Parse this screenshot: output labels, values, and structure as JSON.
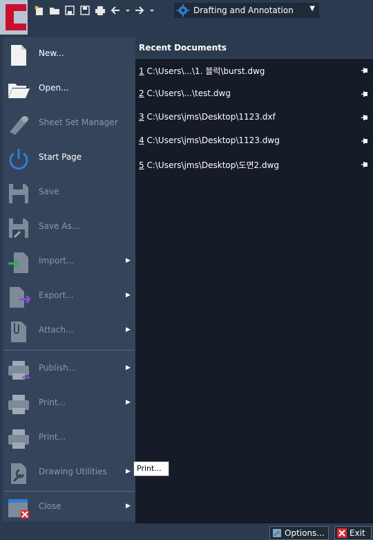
{
  "toolbar": {
    "workspace": "Drafting and Annotation"
  },
  "menu": {
    "items": [
      {
        "label": "New...",
        "icon": "new-icon",
        "enabled": true,
        "submenu": false
      },
      {
        "label": "Open...",
        "icon": "open-folder-icon",
        "enabled": true,
        "submenu": false
      },
      {
        "label": "Sheet Set Manager",
        "icon": "sheet-set-icon",
        "enabled": false,
        "submenu": false
      },
      {
        "label": "Start Page",
        "icon": "power-icon",
        "enabled": true,
        "submenu": false
      },
      {
        "label": "Save",
        "icon": "save-icon",
        "enabled": false,
        "submenu": false
      },
      {
        "label": "Save As...",
        "icon": "save-as-icon",
        "enabled": false,
        "submenu": false
      },
      {
        "label": "Import...",
        "icon": "import-icon",
        "enabled": false,
        "submenu": true
      },
      {
        "label": "Export...",
        "icon": "export-icon",
        "enabled": false,
        "submenu": true
      },
      {
        "label": "Attach...",
        "icon": "attach-icon",
        "enabled": false,
        "submenu": true
      },
      {
        "label": "Publish...",
        "icon": "publish-icon",
        "enabled": false,
        "submenu": true
      },
      {
        "label": "Print...",
        "icon": "print-icon",
        "enabled": false,
        "submenu": true
      },
      {
        "label": "Print...",
        "icon": "print-icon",
        "enabled": false,
        "submenu": false
      },
      {
        "label": "Drawing Utilities",
        "icon": "wrench-icon",
        "enabled": false,
        "submenu": true
      },
      {
        "label": "Close",
        "icon": "close-drawing-icon",
        "enabled": false,
        "submenu": true
      }
    ]
  },
  "recent": {
    "title": "Recent Documents",
    "items": [
      {
        "num": "1",
        "path": " C:\\Users\\...\\1. 블럭\\burst.dwg"
      },
      {
        "num": "2",
        "path": " C:\\Users\\...\\test.dwg"
      },
      {
        "num": "3",
        "path": " C:\\Users\\jms\\Desktop\\1123.dxf"
      },
      {
        "num": "4",
        "path": " C:\\Users\\jms\\Desktop\\1123.dwg"
      },
      {
        "num": "5",
        "path": " C:\\Users\\jms\\Desktop\\도면2.dwg"
      }
    ]
  },
  "tooltip": "Print...",
  "footer": {
    "options": "Options...",
    "exit": "Exit"
  },
  "colors": {
    "accent_blue": "#2e7fd6",
    "logo_red": "#c8102e",
    "disabled_text": "#8c97a8",
    "exit_red": "#d92b2b"
  }
}
